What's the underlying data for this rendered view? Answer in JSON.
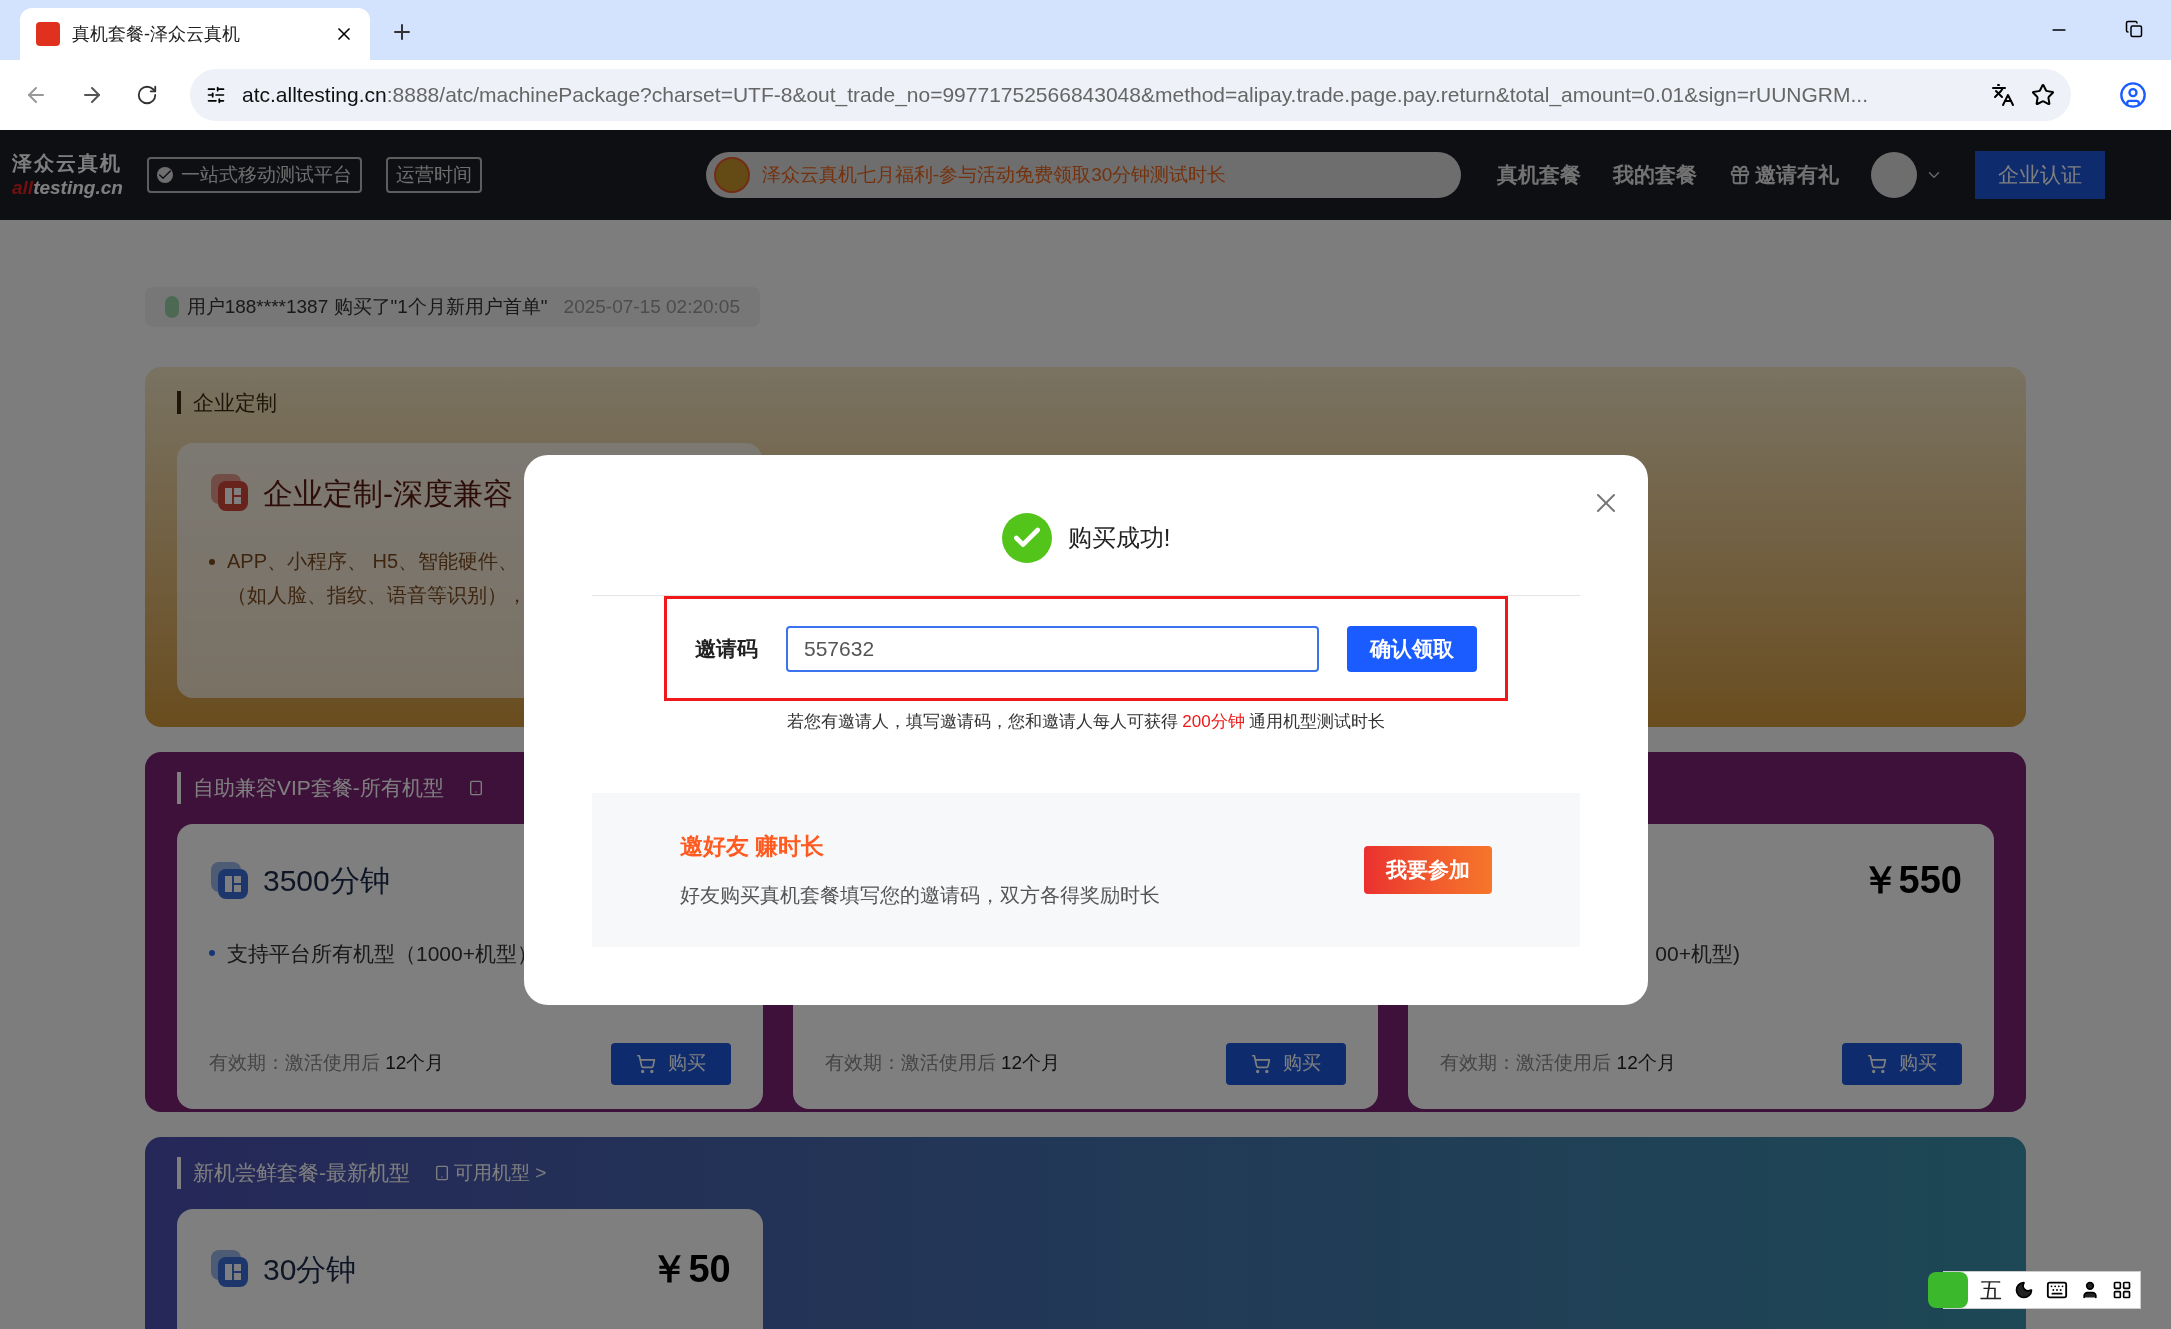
{
  "browser": {
    "tab_title": "真机套餐-泽众云真机",
    "url_host": "atc.alltesting.cn",
    "url_rest": ":8888/atc/machinePackage?charset=UTF-8&out_trade_no=99771752566843048&method=alipay.trade.page.pay.return&total_amount=0.01&sign=rUUNGRM..."
  },
  "header": {
    "logo_cn": "泽众云真机",
    "logo_en_highlight": "all",
    "logo_en_rest": "testing.cn",
    "badges": [
      {
        "label": "一站式移动测试平台",
        "kind": "check"
      },
      {
        "label": "运营时间",
        "kind": "plain"
      }
    ],
    "banner": "泽众云真机七月福利-参与活动免费领取30分钟测试时长",
    "nav": [
      {
        "label": "真机套餐",
        "kind": "plain"
      },
      {
        "label": "我的套餐",
        "kind": "plain"
      },
      {
        "label": "邀请有礼",
        "kind": "gift"
      }
    ],
    "cta": "企业认证"
  },
  "ticker": [
    {
      "user": "用户188****1387",
      "action": "购买了\"1个月新用户首单\"",
      "time": "2025-07-15 02:20:05"
    }
  ],
  "enterprise": {
    "title": "企业定制",
    "card_title": "企业定制-深度兼容",
    "bullet_lines": [
      "APP、小程序、 H5、智能硬件、",
      "（如人脸、指纹、语音等识别），"
    ]
  },
  "vip": {
    "title": "自助兼容VIP套餐-所有机型",
    "cards": [
      {
        "title": "3500分钟",
        "feature": "支持平台所有机型（1000+机型）",
        "validity_label": "有效期：激活使用后",
        "validity_value": "12个月",
        "buy": "购买"
      },
      {
        "validity_label": "有效期：激活使用后",
        "validity_value": "12个月",
        "buy": "购买"
      },
      {
        "price": "￥550",
        "feature": "00+机型)",
        "validity_label": "有效期：激活使用后",
        "validity_value": "12个月",
        "buy": "购买"
      }
    ]
  },
  "newest": {
    "title": "新机尝鲜套餐-最新机型",
    "link": "可用机型 >",
    "cards": [
      {
        "title": "30分钟",
        "price": "￥50"
      }
    ]
  },
  "modal": {
    "title": "购买成功!",
    "invite_label": "邀请码",
    "invite_value": "557632",
    "confirm": "确认领取",
    "hint_before": "若您有邀请人，填写邀请码，您和邀请人每人可获得",
    "hint_highlight": "200分钟",
    "hint_after": "通用机型测试时长",
    "promo_title": "邀好友 赚时长",
    "promo_desc": "好友购买真机套餐填写您的邀请码，双方各得奖励时长",
    "promo_button": "我要参加"
  },
  "ime": {
    "mode": "五"
  }
}
